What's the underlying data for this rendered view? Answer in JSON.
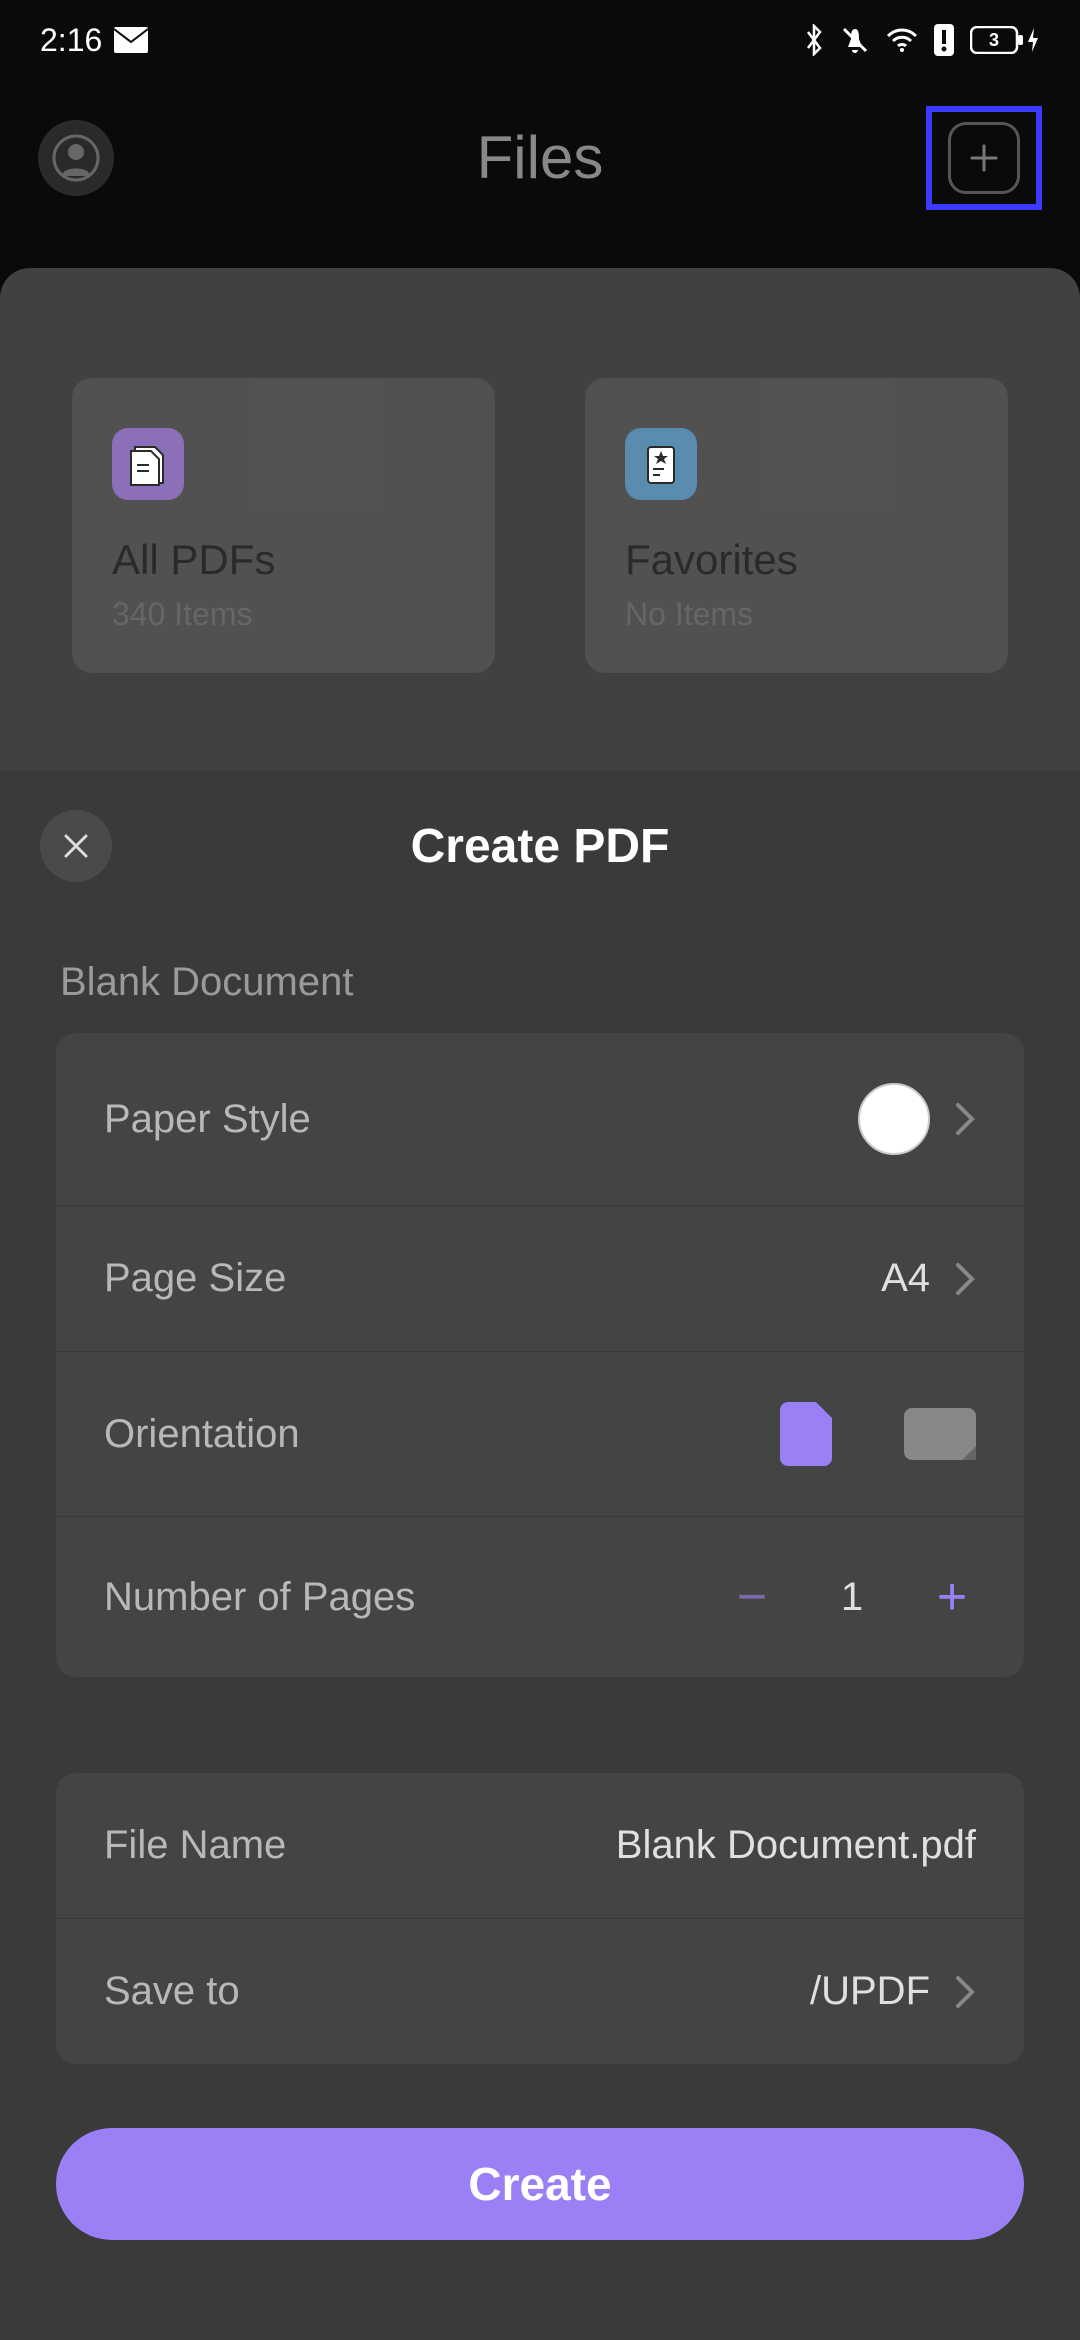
{
  "status": {
    "time": "2:16",
    "battery": "3"
  },
  "header": {
    "title": "Files"
  },
  "cards": {
    "all_pdfs": {
      "title": "All PDFs",
      "sub": "340 Items"
    },
    "favorites": {
      "title": "Favorites",
      "sub": "No Items"
    }
  },
  "sheet": {
    "title": "Create PDF",
    "section_label": "Blank Document",
    "rows": {
      "paper_style": {
        "label": "Paper Style"
      },
      "page_size": {
        "label": "Page Size",
        "value": "A4"
      },
      "orientation": {
        "label": "Orientation"
      },
      "num_pages": {
        "label": "Number of Pages",
        "value": "1"
      },
      "file_name": {
        "label": "File Name",
        "value": "Blank Document.pdf"
      },
      "save_to": {
        "label": "Save to",
        "value": "/UPDF"
      }
    },
    "create_label": "Create"
  },
  "colors": {
    "accent": "#9b7ff5",
    "highlight": "#3b3bff"
  }
}
